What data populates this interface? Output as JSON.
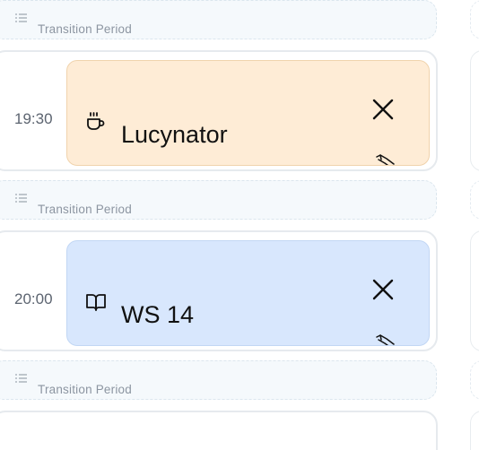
{
  "transition_label": "Transition Period",
  "transitions": [
    {
      "label": "Transition Period"
    },
    {
      "label": "Transition Period"
    },
    {
      "label": "Transition Period"
    }
  ],
  "slots": [
    {
      "time": "19:30",
      "title": "Lucynator",
      "icon": "coffee-icon",
      "color": "#feecd6"
    },
    {
      "time": "20:00",
      "title": "WS 14",
      "icon": "book-icon",
      "color": "#d8e7fd"
    }
  ],
  "icons": {
    "close": "close-icon",
    "drag": "drag-handle-icon",
    "list": "list-icon"
  }
}
